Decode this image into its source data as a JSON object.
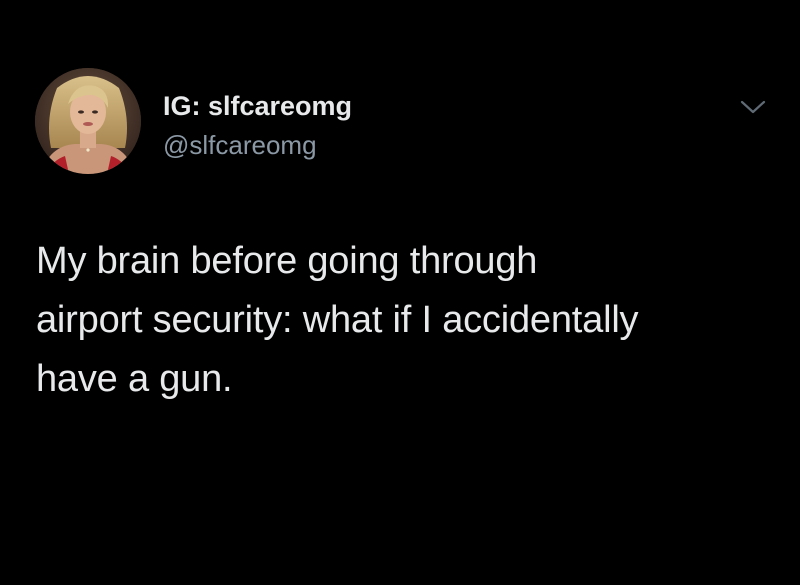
{
  "tweet": {
    "author": {
      "display_name": "IG: slfcareomg",
      "handle": "@slfcareomg",
      "avatar_icon": "profile-photo"
    },
    "menu_icon": "chevron-down-icon",
    "text_lines": [
      "My brain before going through",
      "airport security: what if I accidentally",
      "have a gun."
    ]
  },
  "colors": {
    "background": "#000000",
    "primary_text": "#e7e9ea",
    "secondary_text": "#8b98a5"
  }
}
